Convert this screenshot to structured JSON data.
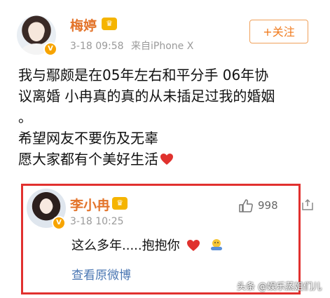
{
  "post": {
    "author": "梅婷",
    "date": "3-18 09:58",
    "source": "来自iPhone X",
    "follow_label": "+关注",
    "text_line1": "我与鄢颇是在05年左右和平分手  06年协",
    "text_line2": "议离婚  小冉真的真的从未插足过我的婚姻",
    "text_line3": "。",
    "text_line4": "希望网友不要伤及无辜",
    "text_line5": "愿大家都有个美好生活"
  },
  "reply": {
    "author": "李小冉",
    "date": "3-18 10:25",
    "likes": "998",
    "text": "这么多年.....抱抱你",
    "view_original": "查看原微博"
  },
  "watermark": "头条 @娱乐蒸姐们儿",
  "colors": {
    "name": "#e3742b",
    "follow": "#f07b1e",
    "highlight_border": "#e1312f",
    "link": "#4b77b3",
    "verified_badge": "#f7a400"
  },
  "icons": [
    "verified-badge-icon",
    "vip-crown-icon",
    "heart-emoji-icon",
    "thumbs-up-icon",
    "hug-emoji-icon",
    "share-icon"
  ]
}
